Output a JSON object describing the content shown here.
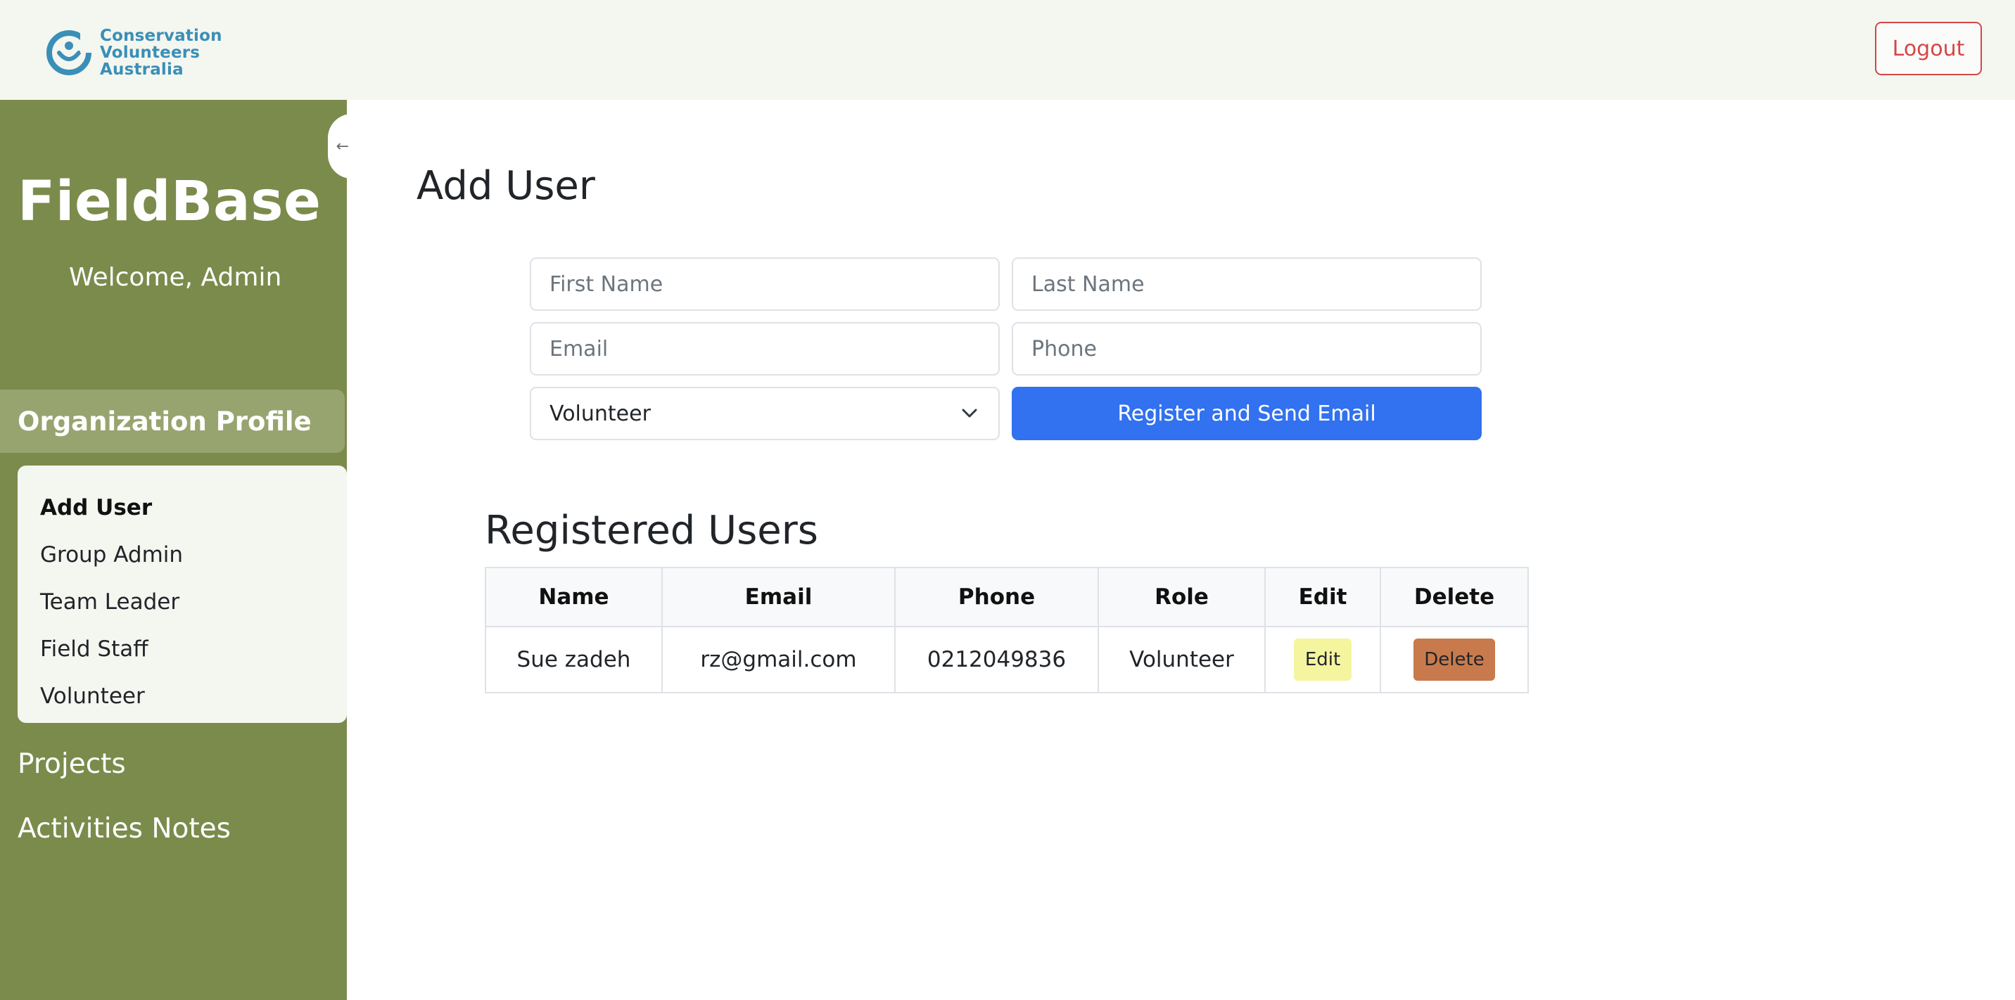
{
  "header": {
    "logo_lines": [
      "Conservation",
      "Volunteers",
      "Australia"
    ],
    "logout_label": "Logout"
  },
  "sidebar": {
    "brand": "FieldBase",
    "welcome": "Welcome, Admin",
    "collapse_icon": "arrow-left-icon",
    "active_section": "Organization Profile",
    "submenu": [
      "Add User",
      "Group Admin",
      "Team Leader",
      "Field Staff",
      "Volunteer"
    ],
    "links": [
      "Projects",
      "Activities Notes"
    ]
  },
  "main": {
    "title": "Add User",
    "form": {
      "first_name_placeholder": "First Name",
      "last_name_placeholder": "Last Name",
      "email_placeholder": "Email",
      "phone_placeholder": "Phone",
      "role_selected": "Volunteer",
      "submit_label": "Register and Send Email"
    },
    "table": {
      "title": "Registered Users",
      "columns": [
        "Name",
        "Email",
        "Phone",
        "Role",
        "Edit",
        "Delete"
      ],
      "rows": [
        {
          "name": "Sue zadeh",
          "email": "rz@gmail.com",
          "phone": "0212049836",
          "role": "Volunteer",
          "edit_label": "Edit",
          "delete_label": "Delete"
        }
      ]
    }
  },
  "colors": {
    "sidebar": "#7b8b4c",
    "sidebar_active": "#97a46f",
    "primary": "#3271ef",
    "logout": "#d64545",
    "edit": "#f4f59e",
    "delete": "#c97a4c",
    "logo": "#3a8fb7"
  }
}
